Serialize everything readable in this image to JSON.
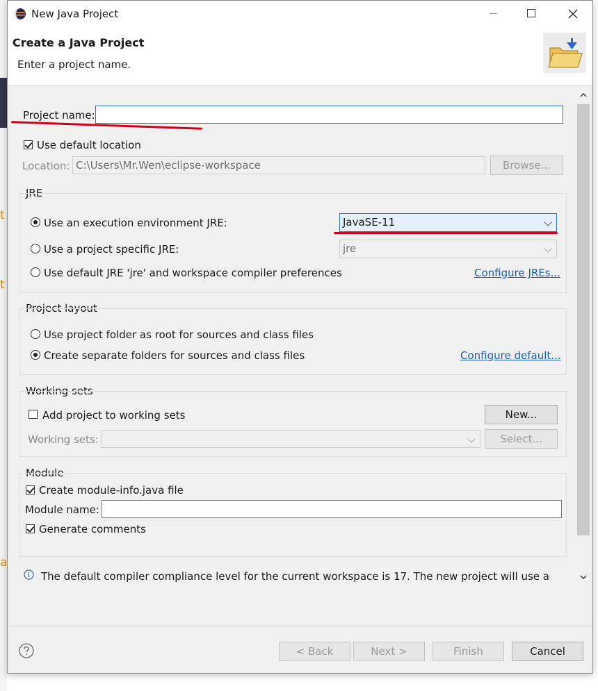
{
  "window": {
    "title": "New Java Project"
  },
  "header": {
    "title": "Create a Java Project",
    "message": "Enter a project name."
  },
  "project": {
    "name_label": "Project name:",
    "name_value": "",
    "use_default_location_label": "Use default location",
    "use_default_location_checked": true,
    "location_label": "Location:",
    "location_value": "C:\\Users\\Mr.Wen\\eclipse-workspace",
    "browse_label": "Browse..."
  },
  "jre": {
    "group_label": "JRE",
    "options": [
      {
        "label": "Use an execution environment JRE:",
        "selected": true
      },
      {
        "label": "Use a project specific JRE:",
        "selected": false
      },
      {
        "label": "Use default JRE 'jre' and workspace compiler preferences",
        "selected": false
      }
    ],
    "execution_env_value": "JavaSE-11",
    "project_jre_value": "jre",
    "configure_link": "Configure JREs..."
  },
  "layout": {
    "group_label": "Project layout",
    "options": [
      {
        "label": "Use project folder as root for sources and class files",
        "selected": false
      },
      {
        "label": "Create separate folders for sources and class files",
        "selected": true
      }
    ],
    "configure_link": "Configure default..."
  },
  "working_sets": {
    "group_label": "Working sets",
    "add_label": "Add project to working sets",
    "add_checked": false,
    "new_label": "New...",
    "sets_label": "Working sets:",
    "select_label": "Select..."
  },
  "module": {
    "group_label": "Module",
    "create_info_label": "Create module-info.java file",
    "create_info_checked": true,
    "name_label": "Module name:",
    "generate_comments_label": "Generate comments",
    "generate_comments_checked": true
  },
  "info": {
    "message": "The default compiler compliance level for the current workspace is 17. The new project will use a"
  },
  "buttons": {
    "back": "< Back",
    "next": "Next >",
    "finish": "Finish",
    "cancel": "Cancel"
  },
  "colors": {
    "annotation": "#d0021b",
    "link": "#1a5fb4",
    "info": "#2b6cb0"
  }
}
